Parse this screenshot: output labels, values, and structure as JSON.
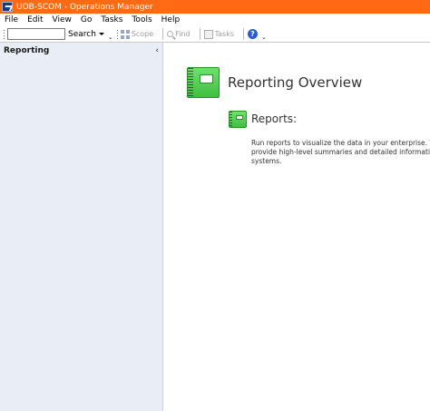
{
  "window": {
    "title": "UOB-SCOM - Operations Manager",
    "titlebar_color": "#ff6a13"
  },
  "menu": {
    "items": [
      "File",
      "Edit",
      "View",
      "Go",
      "Tasks",
      "Tools",
      "Help"
    ]
  },
  "toolbar": {
    "search_value": "",
    "search_label": "Search",
    "scope_label": "Scope",
    "find_label": "Find",
    "tasks_label": "Tasks",
    "help_icon": "help-icon"
  },
  "sidebar": {
    "title": "Reporting",
    "collapse_glyph": "‹"
  },
  "main": {
    "page_title": "Reporting Overview",
    "section_title": "Reports:",
    "description_lines": [
      "Run reports to visualize the data in your enterprise.  The report",
      "provide high-level summaries and detailed information about",
      "systems."
    ]
  },
  "colors": {
    "sidebar_bg": "#e9edf5",
    "icon_green": "#4ccf4c"
  }
}
